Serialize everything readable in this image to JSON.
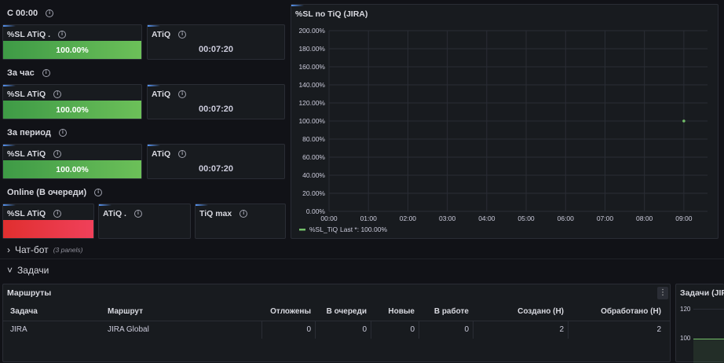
{
  "sections": {
    "c0000": "С 00:00",
    "hour": "За час",
    "period": "За период",
    "online": "Online (В очереди)"
  },
  "stat_panels": {
    "sl_c0000": {
      "title": "%SL ATiQ .",
      "value": "100.00%"
    },
    "atiq_c0000": {
      "title": "ATiQ",
      "value": "00:07:20"
    },
    "sl_hour": {
      "title": "%SL ATiQ",
      "value": "100.00%"
    },
    "atiq_hour": {
      "title": "ATiQ",
      "value": "00:07:20"
    },
    "sl_period": {
      "title": "%SL ATiQ",
      "value": "100.00%"
    },
    "atiq_period": {
      "title": "ATiQ",
      "value": "00:07:20"
    },
    "sl_online": {
      "title": "%SL ATiQ"
    },
    "atiq_online": {
      "title": "ATiQ ."
    },
    "tiq_max": {
      "title": "TiQ max"
    }
  },
  "chart_panel": {
    "title": "%SL no TiQ (JIRA)",
    "legend_label": "%SL_TiQ",
    "legend_stat": "Last *: 100.00%"
  },
  "chart_data": {
    "type": "line",
    "x_ticks": [
      "00:00",
      "01:00",
      "02:00",
      "03:00",
      "04:00",
      "05:00",
      "06:00",
      "07:00",
      "08:00",
      "09:00"
    ],
    "y_ticks": [
      "0.00%",
      "20.00%",
      "40.00%",
      "60.00%",
      "80.00%",
      "100.00%",
      "120.00%",
      "140.00%",
      "160.00%",
      "180.00%",
      "200.00%"
    ],
    "ylim": [
      0,
      200
    ],
    "xlim_hours": [
      0,
      9.6
    ],
    "series": [
      {
        "name": "%SL_TiQ",
        "color": "#73bf69",
        "points": [
          {
            "x": 9.0,
            "y": 100
          }
        ]
      }
    ],
    "grid": true,
    "legend": "bottom-left"
  },
  "rows": {
    "chatbot": {
      "label": "Чат-бот",
      "sub": "(3 panels)"
    },
    "tasks": {
      "label": "Задачи"
    }
  },
  "routes_table": {
    "title": "Маршруты",
    "columns": [
      "Задача",
      "Маршрут",
      "Отложены",
      "В очереди",
      "Новые",
      "В работе",
      "Создано (Н)",
      "Обработано (Н)"
    ],
    "rows": [
      [
        "JIRA",
        "JIRA Global",
        "0",
        "0",
        "0",
        "0",
        "2",
        "2"
      ]
    ]
  },
  "tasks_chart": {
    "title": "Задачи (JIRA",
    "y_ticks": [
      "120",
      "100"
    ]
  },
  "colors": {
    "background": "#111217",
    "panel": "#181b1f",
    "green": "#73bf69",
    "red": "#e02f2f"
  }
}
